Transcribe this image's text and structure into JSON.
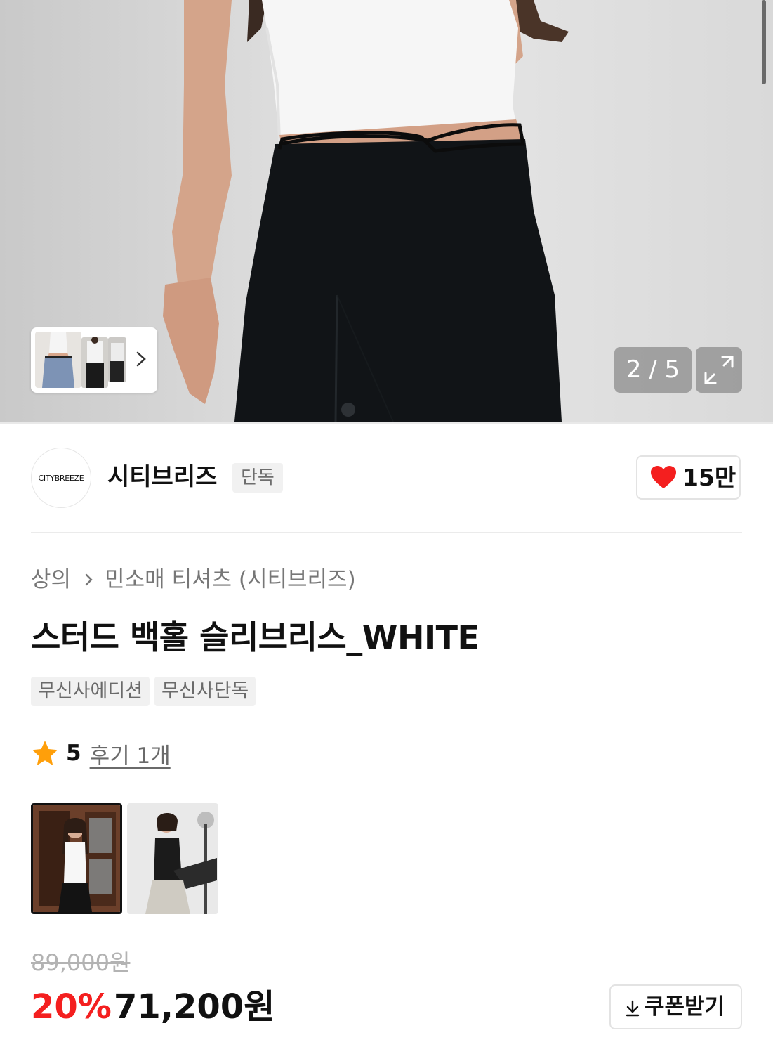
{
  "gallery": {
    "counter": "2 / 5",
    "expand_icon": "expand-icon",
    "thumbnail_next_icon": "chevron-right-icon"
  },
  "brand": {
    "logo_text": "CITYBREEZE",
    "name": "시티브리즈",
    "badge": "단독",
    "like_count": "15만",
    "like_color": "#f41f1f"
  },
  "breadcrumb": {
    "items": [
      "상의",
      "민소매 티셔츠 (시티브리즈)"
    ],
    "separator_icon": "chevron-right-icon"
  },
  "product": {
    "title": "스터드 백홀 슬리브리스_WHITE",
    "tags": [
      "무신사에디션",
      "무신사단독"
    ]
  },
  "rating": {
    "score": "5",
    "reviews_label": "후기 1개",
    "star_color": "#ff9f0a"
  },
  "price": {
    "original": "89,000원",
    "discount_rate": "20%",
    "sale": "71,200원",
    "discount_color": "#f41f1f"
  },
  "coupon": {
    "label": "쿠폰받기",
    "icon": "download-icon"
  }
}
